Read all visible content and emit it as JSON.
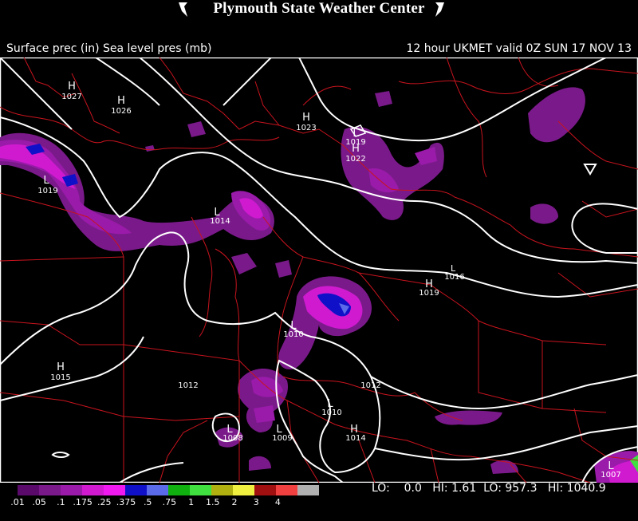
{
  "header": {
    "title": "Plymouth State Weather Center"
  },
  "subtitle": {
    "left": "Surface prec (in) Sea level pres (mb)",
    "right": "12 hour UKMET valid 0Z SUN 17 NOV 13"
  },
  "pressure_centers": [
    {
      "type": "H",
      "value": "1027"
    },
    {
      "type": "H",
      "value": "1026"
    },
    {
      "type": "H",
      "value": "1023"
    },
    {
      "type": "L",
      "value": "1019"
    },
    {
      "type": "H",
      "value": "1022"
    },
    {
      "type": "L",
      "value": "1019"
    },
    {
      "type": "L",
      "value": "1014"
    },
    {
      "type": "L",
      "value": "1016"
    },
    {
      "type": "H",
      "value": "1019"
    },
    {
      "type": "L",
      "value": "1010"
    },
    {
      "type": "H",
      "value": "1015"
    },
    {
      "type": "L",
      "value": "1010"
    },
    {
      "type": "H",
      "value": "1014"
    },
    {
      "type": "L",
      "value": "1008"
    },
    {
      "type": "L",
      "value": "1009"
    },
    {
      "type": "L",
      "value": "1007"
    }
  ],
  "isobar_labels": [
    "1012",
    "1012"
  ],
  "legend": {
    "colors": [
      "#5a0a6a",
      "#7a1a8a",
      "#9a1aaa",
      "#d01ad0",
      "#f01af0",
      "#1010c8",
      "#5a6ae8",
      "#10b010",
      "#40e040",
      "#b0b010",
      "#f0f040",
      "#a01010",
      "#f04040",
      "#b0b0b0"
    ],
    "tick_labels": [
      ".01",
      ".05",
      ".1",
      ".175",
      ".25",
      ".375",
      ".5",
      ".75",
      "1",
      "1.5",
      "2",
      "3",
      "4"
    ]
  },
  "stats": {
    "lo_label": "LO:",
    "lo_val": "0.0",
    "hi_label": "HI:",
    "hi_val": "1.61",
    "lo2_label": "LO:",
    "lo2_val": "957.3",
    "hi2_label": "HI:",
    "hi2_val": "1040.9"
  }
}
